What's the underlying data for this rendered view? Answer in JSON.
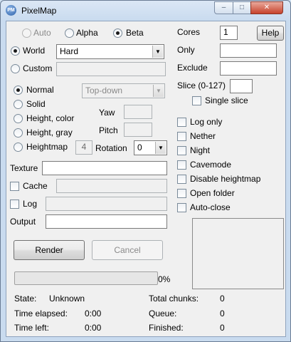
{
  "window": {
    "title": "PixelMap",
    "icon_text": "PM",
    "controls": {
      "minimize": "–",
      "maximize": "□",
      "close": "✕"
    }
  },
  "alpha_mode": {
    "auto": "Auto",
    "alpha": "Alpha",
    "beta": "Beta",
    "selected": "Beta"
  },
  "source": {
    "world_label": "World",
    "world_value": "Hard",
    "custom_label": "Custom",
    "custom_value": "",
    "selected": "World"
  },
  "render_mode": {
    "normal": "Normal",
    "solid": "Solid",
    "height_color": "Height, color",
    "height_gray": "Height, gray",
    "heightmap": "Heightmap",
    "heightmap_value": "4",
    "selected": "Normal",
    "view": "Top-down",
    "yaw_label": "Yaw",
    "yaw_value": "",
    "pitch_label": "Pitch",
    "pitch_value": "",
    "rotation_label": "Rotation",
    "rotation_value": "0"
  },
  "texture": {
    "label": "Texture",
    "value": ""
  },
  "cache": {
    "label": "Cache",
    "value": "",
    "checked": false
  },
  "log": {
    "label": "Log",
    "value": "",
    "checked": false
  },
  "output": {
    "label": "Output",
    "value": ""
  },
  "actions": {
    "render": "Render",
    "cancel": "Cancel"
  },
  "progress": {
    "fraction": 0,
    "text": "0%"
  },
  "status": {
    "state_label": "State:",
    "state_value": "Unknown",
    "elapsed_label": "Time elapsed:",
    "elapsed_value": "0:00",
    "left_label": "Time left:",
    "left_value": "0:00",
    "total_chunks_label": "Total chunks:",
    "total_chunks_value": "0",
    "queue_label": "Queue:",
    "queue_value": "0",
    "finished_label": "Finished:",
    "finished_value": "0"
  },
  "options": {
    "cores_label": "Cores",
    "cores_value": "1",
    "help_label": "Help",
    "only_label": "Only",
    "only_value": "",
    "exclude_label": "Exclude",
    "exclude_value": "",
    "slice_label": "Slice (0-127)",
    "slice_value": "",
    "single_slice": "Single slice",
    "log_only": "Log only",
    "nether": "Nether",
    "night": "Night",
    "cavemode": "Cavemode",
    "disable_heightmap": "Disable heightmap",
    "open_folder": "Open folder",
    "auto_close": "Auto-close"
  }
}
